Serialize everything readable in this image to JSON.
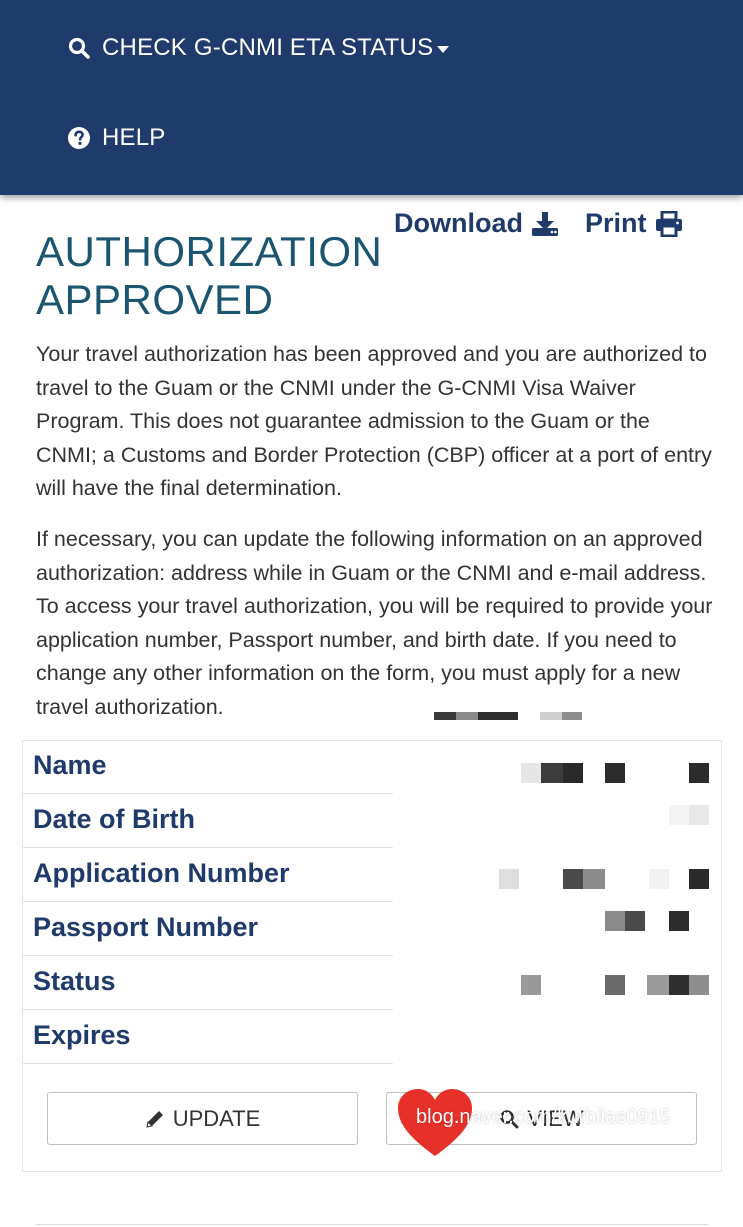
{
  "nav": {
    "items": [
      {
        "label": "CHECK G-CNMI ETA STATUS",
        "icon": "search-icon"
      },
      {
        "label": "HELP",
        "icon": "question-circle-icon"
      }
    ]
  },
  "actions": {
    "download_label": "Download",
    "print_label": "Print"
  },
  "title": {
    "line1": "AUTHORIZATION",
    "line2": "APPROVED"
  },
  "paragraphs": [
    "Your travel authorization has been approved and you are authorized to travel to the Guam or the CNMI under the G-CNMI Visa Waiver Program. This does not guarantee admission to the Guam or the CNMI; a Customs and Border Protection (CBP) officer at a port of entry will have the final determination.",
    "If necessary, you can update the following information on an approved authorization: address while in Guam or the CNMI and e-mail address. To access your travel authorization, you will be required to provide your application number, Passport number, and birth date. If you need to change any other information on the form, you must apply for a new travel authorization."
  ],
  "details": {
    "rows": [
      {
        "label": "Name"
      },
      {
        "label": "Date of Birth"
      },
      {
        "label": "Application Number"
      },
      {
        "label": "Passport Number"
      },
      {
        "label": "Status"
      },
      {
        "label": "Expires"
      }
    ]
  },
  "buttons": {
    "update_label": "UPDATE",
    "view_label": "VIEW"
  },
  "watermark": {
    "text": "blog.naver.com/kurbilas0915"
  },
  "colors": {
    "nav_bg": "#1f3b6b",
    "title": "#1b5570",
    "label": "#1f3b6b",
    "watermark_heart": "#e8302a"
  }
}
